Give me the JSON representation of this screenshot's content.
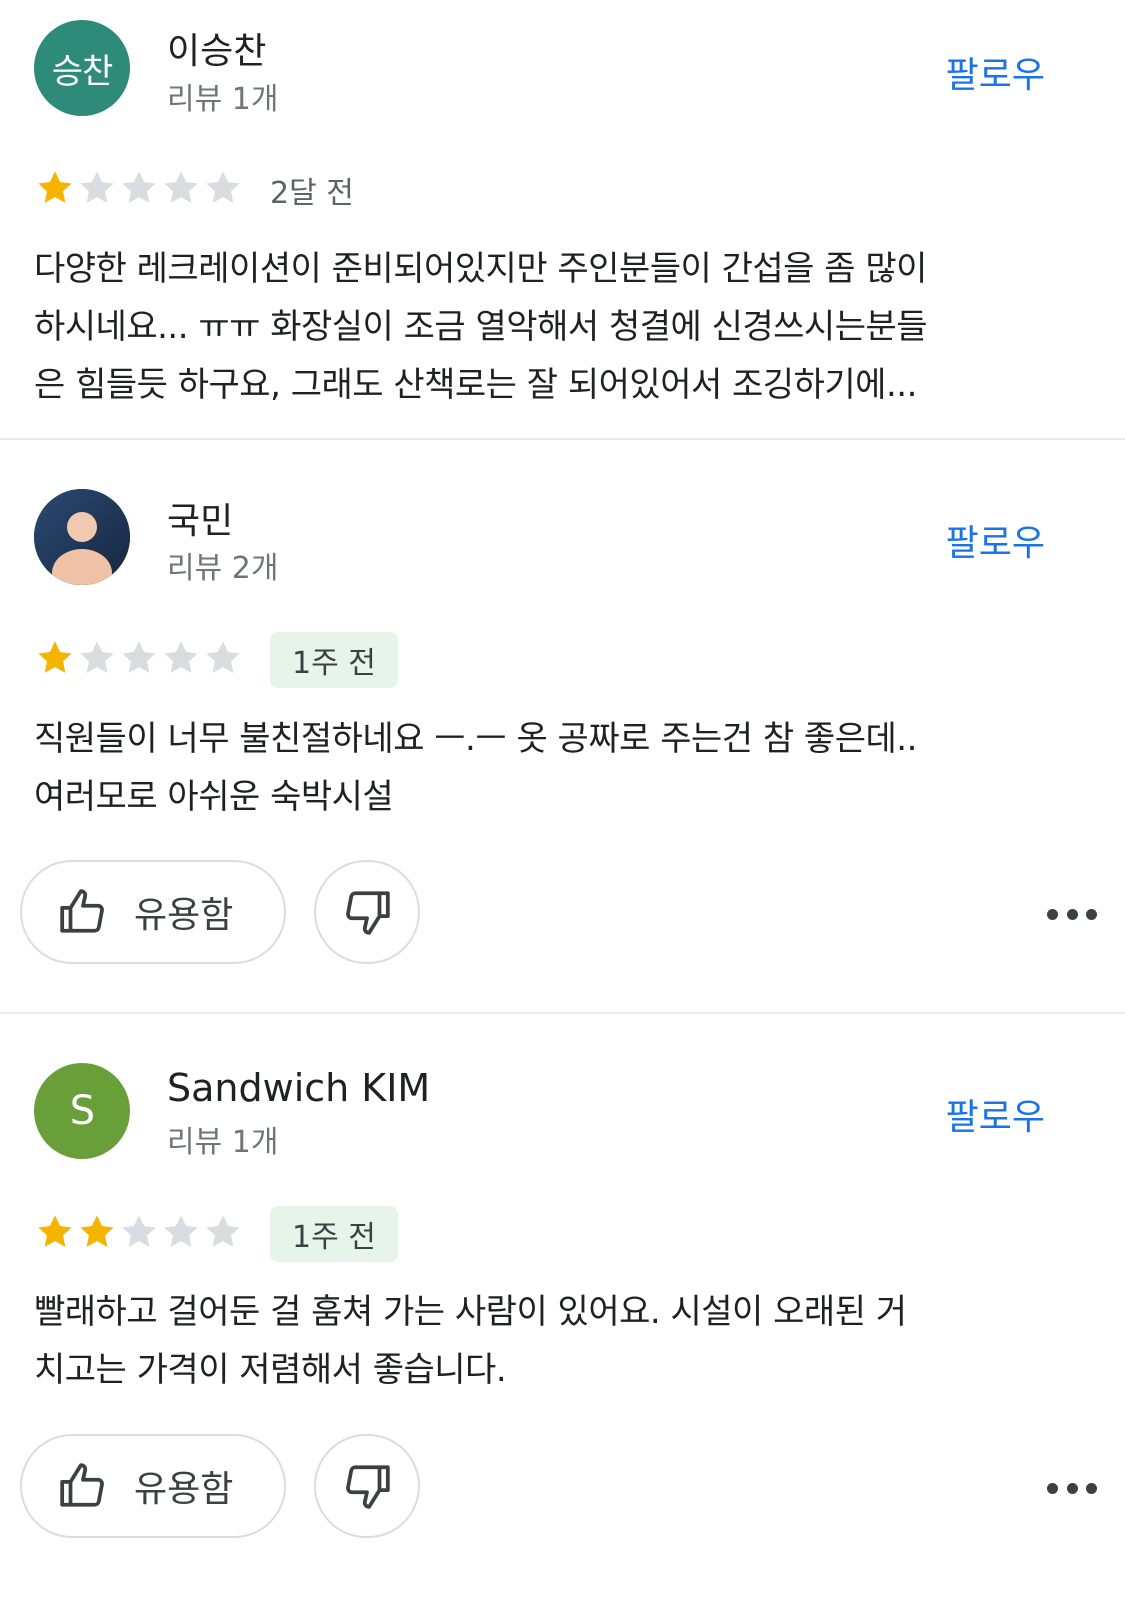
{
  "reviews": [
    {
      "avatar_text": "승찬",
      "avatar_color": "#2e8b7a",
      "name": "이승찬",
      "review_count": "리뷰 1개",
      "follow_label": "팔로우",
      "rating": 1,
      "time": "2달 전",
      "text": "다양한 레크레이션이 준비되어있지만 주인분들이 간섭을 좀 많이\n하시네요... ㅠㅠ 화장실이 조금 열악해서 청결에 신경쓰시는분들\n은 힘들듯 하구요, 그래도 산책로는 잘 되어있어서 조깅하기에..."
    },
    {
      "avatar_icon": "default-person-icon",
      "avatar_color": "#1f3a5f",
      "name": "국민",
      "review_count": "리뷰 2개",
      "follow_label": "팔로우",
      "rating": 1,
      "time": "1주 전",
      "text": "직원들이 너무 불친절하네요 ㅡ.ㅡ 옷 공짜로 주는건 참 좋은데..\n여러모로 아쉬운 숙박시설",
      "helpful_label": "유용함"
    },
    {
      "avatar_text": "S",
      "avatar_color": "#689f38",
      "name": "Sandwich KIM",
      "review_count": "리뷰 1개",
      "follow_label": "팔로우",
      "rating": 2,
      "time": "1주 전",
      "text": "빨래하고 걸어둔 걸 훔쳐 가는 사람이 있어요. 시설이 오래된 거\n치고는 가격이  저렴해서 좋습니다.",
      "helpful_label": "유용함"
    }
  ],
  "colors": {
    "star_filled": "#f4b400",
    "star_empty": "#dadce0",
    "follow": "#1a73e8",
    "recent_badge_bg": "#e6f4ea"
  }
}
